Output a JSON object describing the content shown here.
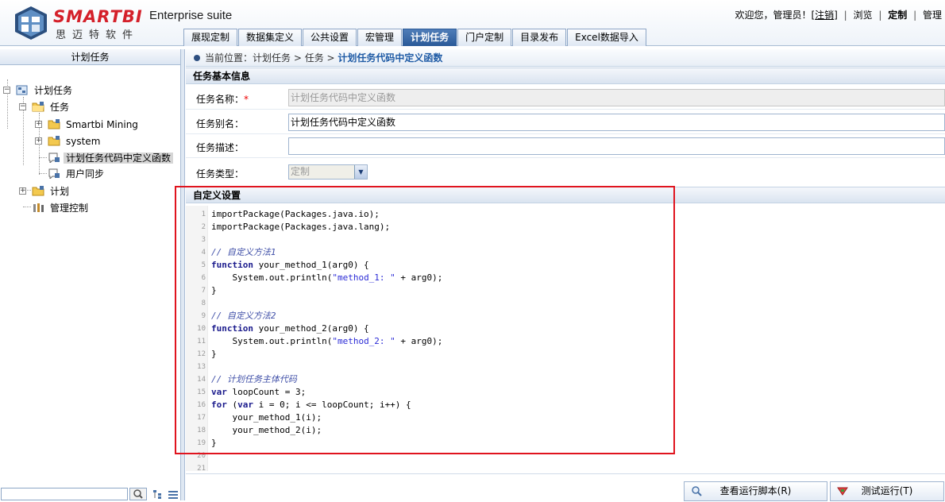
{
  "header": {
    "brand": "SMARTBI",
    "brand_cn": "思迈特软件",
    "suite": "Enterprise suite",
    "welcome": "欢迎您，管理员！[",
    "logout": "注销",
    "welcome_end": "]",
    "link_browse": "浏览",
    "link_custom": "定制",
    "link_manage": "管理"
  },
  "tabs": [
    {
      "label": "展现定制",
      "active": false
    },
    {
      "label": "数据集定义",
      "active": false
    },
    {
      "label": "公共设置",
      "active": false
    },
    {
      "label": "宏管理",
      "active": false
    },
    {
      "label": "计划任务",
      "active": true
    },
    {
      "label": "门户定制",
      "active": false
    },
    {
      "label": "目录发布",
      "active": false
    },
    {
      "label": "Excel数据导入",
      "active": false
    }
  ],
  "sidebar": {
    "title": "计划任务",
    "tree": {
      "root": "计划任务",
      "task_folder": "任务",
      "mining": "Smartbi Mining",
      "system": "system",
      "custom_task": "计划任务代码中定义函数",
      "user_sync": "用户同步",
      "plan_folder": "计划",
      "control": "管理控制"
    }
  },
  "breadcrumb": {
    "prefix": "当前位置：",
    "path": "计划任务 > 任务 > ",
    "current": "计划任务代码中定义函数"
  },
  "form": {
    "section_basic": "任务基本信息",
    "name_label": "任务名称：",
    "name_required": "*",
    "name_value": "计划任务代码中定义函数",
    "alias_label": "任务别名：",
    "alias_value": "计划任务代码中定义函数",
    "desc_label": "任务描述：",
    "desc_value": "",
    "type_label": "任务类型：",
    "type_value": "定制",
    "section_custom": "自定义设置"
  },
  "code": {
    "line_numbers": [
      "1",
      "2",
      "3",
      "4",
      "5",
      "6",
      "7",
      "8",
      "9",
      "10",
      "11",
      "12",
      "13",
      "14",
      "15",
      "16",
      "17",
      "18",
      "19",
      "20",
      "21"
    ],
    "l1": "importPackage(Packages.java.io);",
    "l2": "importPackage(Packages.java.lang);",
    "l4": "// 自定义方法1",
    "l5_kw": "function",
    "l5_rest": " your_method_1(arg0) {",
    "l6_a": "    System.out.println(",
    "l6_s": "\"method_1: \"",
    "l6_b": " + arg0);",
    "l7": "}",
    "l9": "// 自定义方法2",
    "l10_kw": "function",
    "l10_rest": " your_method_2(arg0) {",
    "l11_a": "    System.out.println(",
    "l11_s": "\"method_2: \"",
    "l11_b": " + arg0);",
    "l12": "}",
    "l14": "// 计划任务主体代码",
    "l15_kw": "var",
    "l15_rest": " loopCount = 3;",
    "l16_kw1": "for",
    "l16_a": " (",
    "l16_kw2": "var",
    "l16_b": " i = 0; i <= loopCount; i++) {",
    "l17": "    your_method_1(i);",
    "l18": "    your_method_2(i);",
    "l19": "}"
  },
  "buttons": {
    "view_script": "查看运行脚本(R)",
    "test_run": "测试运行(T)"
  }
}
